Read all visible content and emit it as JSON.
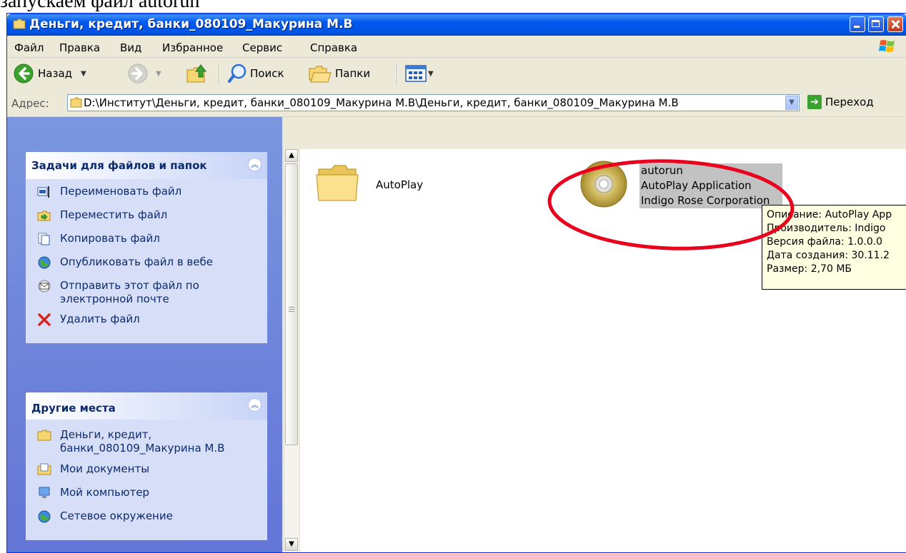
{
  "caption": "запускаем файл autorun",
  "window": {
    "title": "Деньги, кредит, банки_080109_Макурина М.В"
  },
  "menu": [
    "Файл",
    "Правка",
    "Вид",
    "Избранное",
    "Сервис",
    "Справка"
  ],
  "toolbar": {
    "back_label": "Назад",
    "search_label": "Поиск",
    "folders_label": "Папки"
  },
  "address": {
    "label": "Адрес:",
    "path": "D:\\Институт\\Деньги, кредит, банки_080109_Макурина М.В\\Деньги, кредит, банки_080109_Макурина М.В",
    "go_label": "Переход"
  },
  "tasks_panel": {
    "title": "Задачи для файлов и папок",
    "items": [
      "Переименовать файл",
      "Переместить файл",
      "Копировать файл",
      "Опубликовать файл в вебе",
      "Отправить этот файл по электронной почте",
      "Удалить файл"
    ]
  },
  "places_panel": {
    "title": "Другие места",
    "items": [
      "Деньги, кредит, банки_080109_Макурина М.В",
      "Мои документы",
      "Мой компьютер",
      "Сетевое окружение"
    ]
  },
  "files": {
    "folder_name": "AutoPlay",
    "autorun": {
      "name": "autorun",
      "description": "AutoPlay Application",
      "company": "Indigo Rose Corporation"
    }
  },
  "tooltip": {
    "line1": "Описание: AutoPlay App",
    "line2": "Производитель: Indigo",
    "line3": "Версия файла: 1.0.0.0",
    "line4": "Дата создания: 30.11.2",
    "line5": "Размер: 2,70 МБ"
  },
  "colors": {
    "titlebar": "#0054e3",
    "taskpane": "#6375d6",
    "annotation": "#e8001c"
  }
}
